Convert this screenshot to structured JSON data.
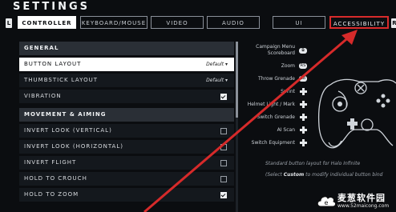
{
  "title": "SETTINGS",
  "bumpers": {
    "left": "L",
    "right": "R"
  },
  "tabs": [
    {
      "label": "CONTROLLER"
    },
    {
      "label": "KEYBOARD/MOUSE"
    },
    {
      "label": "VIDEO"
    },
    {
      "label": "AUDIO"
    },
    {
      "label": "UI"
    },
    {
      "label": "ACCESSIBILITY"
    }
  ],
  "general": {
    "header": "GENERAL",
    "button_layout": {
      "label": "BUTTON LAYOUT",
      "value": "Default"
    },
    "thumbstick_layout": {
      "label": "THUMBSTICK LAYOUT",
      "value": "Default"
    },
    "vibration": {
      "label": "VIBRATION",
      "checked": true
    }
  },
  "movement": {
    "header": "MOVEMENT & AIMING",
    "invert_look_vertical": {
      "label": "INVERT LOOK (VERTICAL)",
      "checked": false
    },
    "invert_look_horizontal": {
      "label": "INVERT LOOK (HORIZONTAL)",
      "checked": false
    },
    "invert_flight": {
      "label": "INVERT FLIGHT",
      "checked": false
    },
    "hold_to_crouch": {
      "label": "HOLD TO CROUCH",
      "checked": false
    },
    "hold_to_zoom": {
      "label": "HOLD TO ZOOM",
      "checked": true
    }
  },
  "mapping": {
    "campaign_menu": "Campaign Menu",
    "scoreboard": "Scoreboard",
    "zoom": "Zoom",
    "throw_grenade": "Throw Grenade",
    "sprint": "Sprint",
    "helmet_light": "Helmet Light / Mark",
    "switch_grenade": "Switch Grenade",
    "ai_scan": "AI Scan",
    "switch_equipment": "Switch Equipment"
  },
  "footnote": {
    "line1": "Standard button layout for Halo Infinite",
    "line2_prefix": "(Select ",
    "line2_bold": "Custom",
    "line2_suffix": " to modify individual button bind"
  },
  "watermark": {
    "name": "麦葱软件园",
    "url": "www.52maicong.com"
  }
}
